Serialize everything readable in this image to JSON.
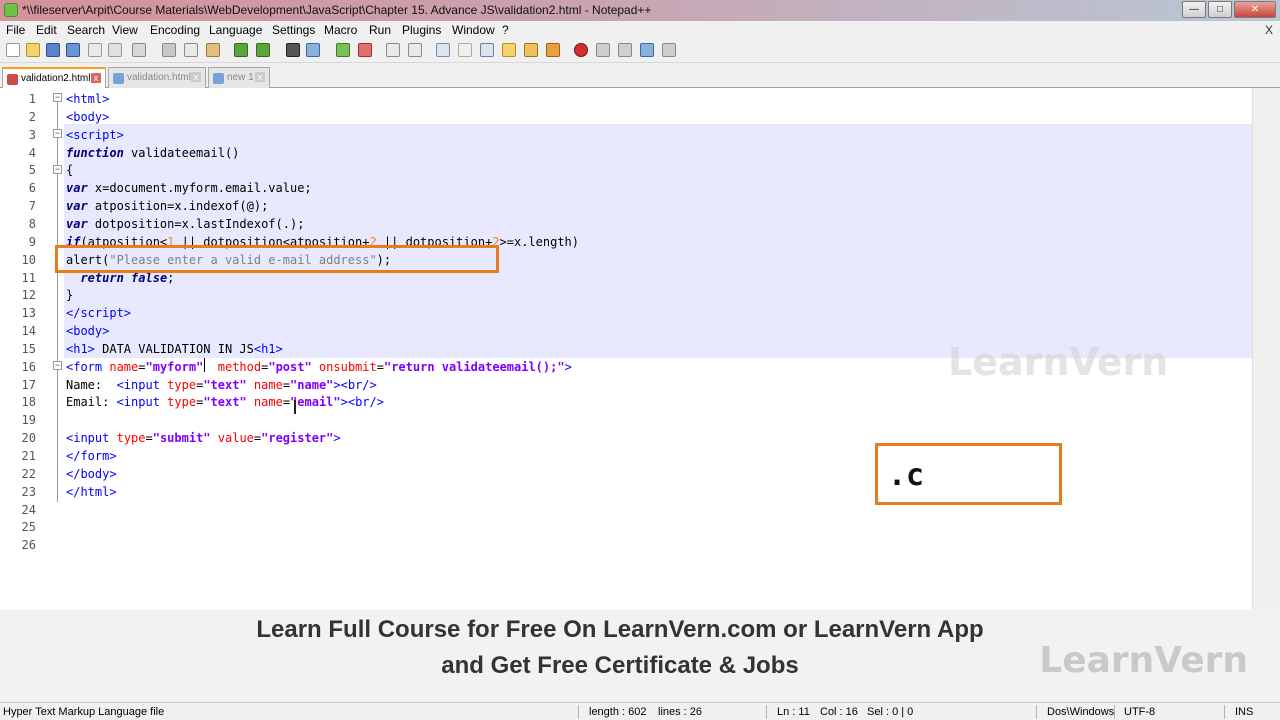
{
  "window": {
    "title": "*\\\\fileserver\\Arpit\\Course Materials\\WebDevelopment\\JavaScript\\Chapter 15. Advance JS\\validation2.html - Notepad++",
    "close_x": "X"
  },
  "menu": [
    "File",
    "Edit",
    "Search",
    "View",
    "Encoding",
    "Language",
    "Settings",
    "Macro",
    "Run",
    "Plugins",
    "Window",
    "?"
  ],
  "tabs": [
    {
      "label": "validation2.html",
      "active": true
    },
    {
      "label": "validation.html",
      "active": false
    },
    {
      "label": "new 1",
      "active": false
    }
  ],
  "code": [
    {
      "n": "1",
      "html": "<span class='k-tag'>&lt;html&gt;</span>"
    },
    {
      "n": "2",
      "html": "<span class='k-tag'>&lt;body&gt;</span>"
    },
    {
      "n": "3",
      "html": "<span class='k-tag'>&lt;script&gt;</span>"
    },
    {
      "n": "4",
      "html": "<span class='k-kw'>function</span> validateemail()"
    },
    {
      "n": "5",
      "html": "{"
    },
    {
      "n": "6",
      "html": "<span class='k-kw'>var</span> x=document.myform.email.value;"
    },
    {
      "n": "7",
      "html": "<span class='k-kw'>var</span> atposition=x.indexof(@);"
    },
    {
      "n": "8",
      "html": "<span class='k-kw'>var</span> dotposition=x.lastIndexof(.);"
    },
    {
      "n": "9",
      "html": "<span class='k-kw'>if</span>(atposition&lt;<span class='k-num'>1</span> || dotposition&lt;atposition+<span class='k-num'>2</span> || dotposition+<span class='k-num'>2</span>&gt;=x.length)"
    },
    {
      "n": "10",
      "html": "alert(<span class='k-str'>\"Please enter a valid e-mail address\"</span>);"
    },
    {
      "n": "11",
      "html": "  <span class='k-kw'>return</span> <span class='k-kw'>false</span>;"
    },
    {
      "n": "12",
      "html": "}"
    },
    {
      "n": "13",
      "html": "<span class='k-tag'>&lt;/script&gt;</span>"
    },
    {
      "n": "14",
      "html": "<span class='k-tag'>&lt;body&gt;</span>"
    },
    {
      "n": "15",
      "html": "<span class='k-tag'>&lt;h1&gt;</span> DATA VALIDATION IN JS<span class='k-tag'>&lt;h1&gt;</span>"
    },
    {
      "n": "16",
      "html": "<span class='k-tag'>&lt;form</span> <span class='k-attr'>name</span>=<span class='k-val'>\"myform\"</span>  <span class='k-attr'>method</span>=<span class='k-val'>\"post\"</span> <span class='k-attr'>onsubmit</span>=<span class='k-val'>\"return validateemail();\"</span><span class='k-tag'>&gt;</span>"
    },
    {
      "n": "17",
      "html": "Name:  <span class='k-tag'>&lt;input</span> <span class='k-attr'>type</span>=<span class='k-val'>\"text\"</span> <span class='k-attr'>name</span>=<span class='k-val'>\"name\"</span><span class='k-tag'>&gt;&lt;br/&gt;</span>"
    },
    {
      "n": "18",
      "html": "Email: <span class='k-tag'>&lt;input</span> <span class='k-attr'>type</span>=<span class='k-val'>\"text\"</span> <span class='k-attr'>name</span>=<span class='k-val'>\"email\"</span><span class='k-tag'>&gt;&lt;br/&gt;</span>"
    },
    {
      "n": "19",
      "html": ""
    },
    {
      "n": "20",
      "html": "<span class='k-tag'>&lt;input</span> <span class='k-attr'>type</span>=<span class='k-val'>\"submit\"</span> <span class='k-attr'>value</span>=<span class='k-val'>\"register\"</span><span class='k-tag'>&gt;</span>"
    },
    {
      "n": "21",
      "html": "<span class='k-tag'>&lt;/form&gt;</span>"
    },
    {
      "n": "22",
      "html": "<span class='k-tag'>&lt;/body&gt;</span>"
    },
    {
      "n": "23",
      "html": "<span class='k-tag'>&lt;/html&gt;</span>"
    },
    {
      "n": "24",
      "html": ""
    },
    {
      "n": "25",
      "html": ""
    },
    {
      "n": "26",
      "html": ""
    }
  ],
  "overlay": {
    "box_text": ".c",
    "watermark": "LearnVern"
  },
  "banner": {
    "line1": "Learn Full Course for Free On LearnVern.com or LearnVern App",
    "line2": "and Get Free Certificate & Jobs",
    "watermark": "LearnVern"
  },
  "status": {
    "file_type": "Hyper Text Markup Language file",
    "length": "length : 602",
    "lines": "lines : 26",
    "ln": "Ln : 11",
    "col": "Col : 16",
    "sel": "Sel : 0 | 0",
    "eol": "Dos\\Windows",
    "encoding": "UTF-8",
    "mode": "INS"
  },
  "colors": {
    "accent_orange": "#e87d1e",
    "tag_blue": "#0000ff",
    "attr_red": "#ff0000",
    "value_purple": "#8000ff"
  }
}
